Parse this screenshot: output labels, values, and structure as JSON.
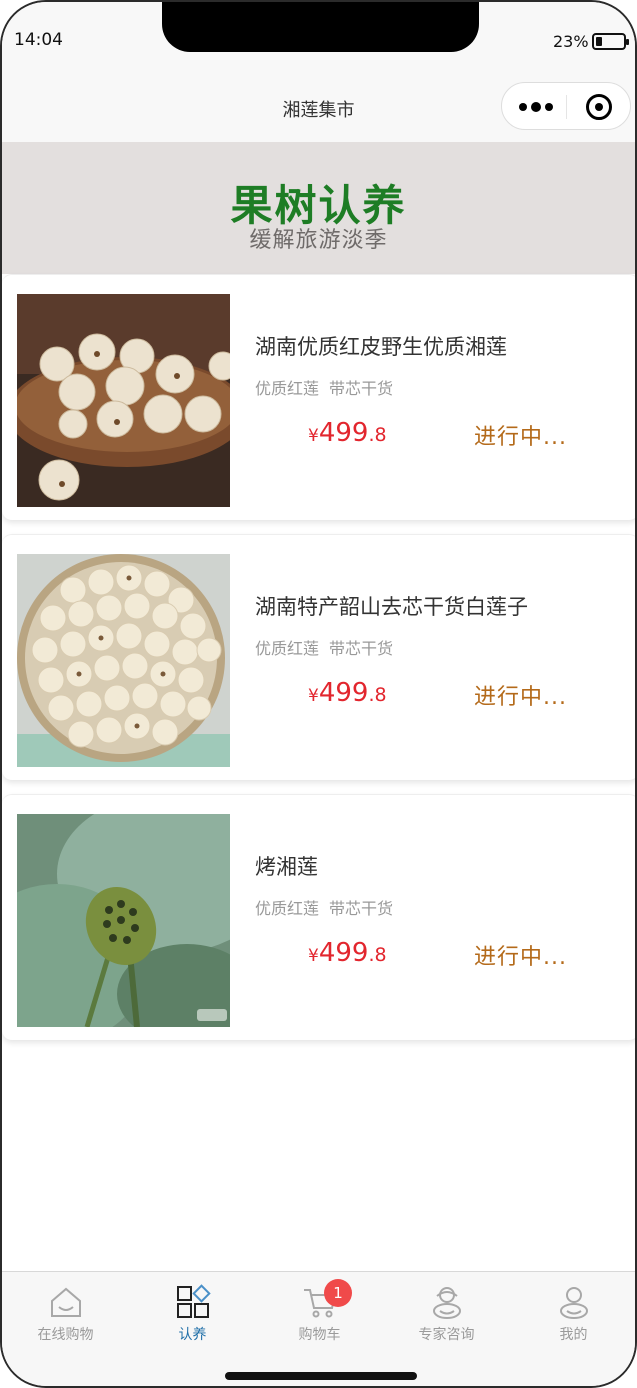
{
  "status_bar": {
    "time": "14:04",
    "battery": "23%"
  },
  "nav": {
    "title": "湘莲集市"
  },
  "banner": {
    "title": "果树认养",
    "subtitle": "缓解旅游淡季"
  },
  "products": [
    {
      "title": "湖南优质红皮野生优质湘莲",
      "tags": [
        "优质红莲",
        "带芯干货"
      ],
      "currency": "¥",
      "price_int": "499",
      "price_dec": ".8",
      "status": "进行中..."
    },
    {
      "title": "湖南特产韶山去芯干货白莲子",
      "tags": [
        "优质红莲",
        "带芯干货"
      ],
      "currency": "¥",
      "price_int": "499",
      "price_dec": ".8",
      "status": "进行中..."
    },
    {
      "title": "烤湘莲",
      "tags": [
        "优质红莲",
        "带芯干货"
      ],
      "currency": "¥",
      "price_int": "499",
      "price_dec": ".8",
      "status": "进行中..."
    }
  ],
  "tabbar": {
    "active": "认养",
    "items": [
      {
        "label": "在线购物",
        "icon": "house-icon"
      },
      {
        "label": "认养",
        "icon": "grid-icon"
      },
      {
        "label": "购物车",
        "icon": "cart-icon"
      },
      {
        "label": "专家咨询",
        "icon": "expert-icon"
      },
      {
        "label": "我的",
        "icon": "user-icon"
      }
    ],
    "cart_badge": "1"
  },
  "colors": {
    "accent_green": "#1e7d25",
    "price_red": "#e2262e",
    "status_orange": "#b46a1a",
    "tab_active": "#1f6fa8"
  }
}
